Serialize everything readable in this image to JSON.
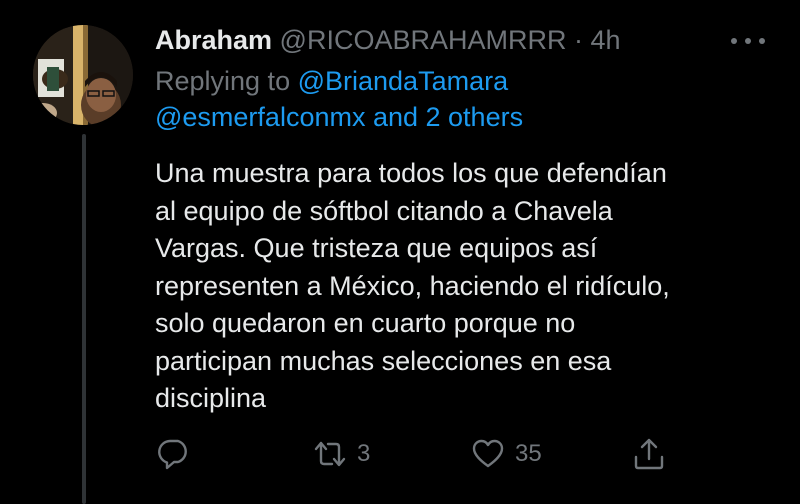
{
  "author": {
    "name": "Abraham",
    "handle": "@RICOABRAHAMRRR",
    "separator": "·",
    "time": "4h"
  },
  "reply": {
    "prefix": "Replying to ",
    "mention_primary": "@BriandaTamara",
    "mention_secondary": "@esmerfalconmx",
    "others_text": " and 2 others"
  },
  "body_lines": [
    "Una muestra para todos los que defendían",
    "al equipo de sóftbol citando a Chavela",
    "Vargas. Que tristeza que equipos así",
    "representen a México, haciendo el ridículo,",
    "solo quedaron en cuarto porque no",
    "participan muchas selecciones en esa",
    "disciplina"
  ],
  "actions": {
    "retweet_count": "3",
    "like_count": "35"
  },
  "icons": {
    "more": "more-icon",
    "reply": "reply-icon",
    "retweet": "retweet-icon",
    "like": "heart-icon",
    "share": "share-icon"
  },
  "colors": {
    "background": "#000000",
    "text": "#e7e9ea",
    "muted": "#71767b",
    "link": "#1d9bf0"
  }
}
